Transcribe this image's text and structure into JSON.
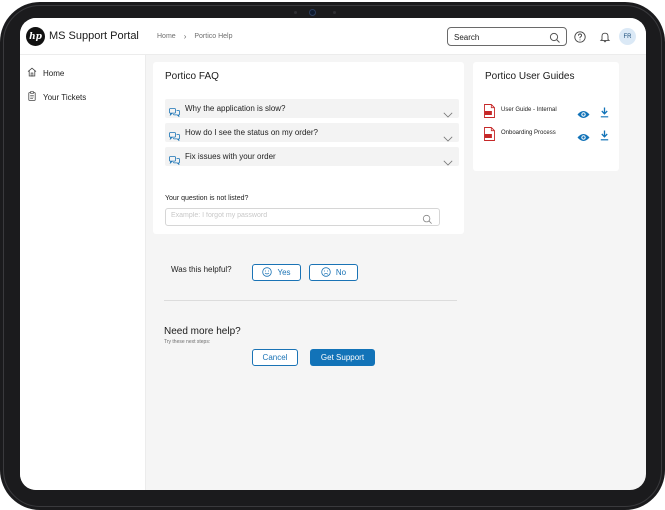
{
  "app": {
    "title": "MS Support Portal",
    "logo_text": "hp"
  },
  "breadcrumb": {
    "home": "Home",
    "current": "Portico Help"
  },
  "search": {
    "placeholder": "Search"
  },
  "avatar": {
    "initials": "FR"
  },
  "sidebar": {
    "items": [
      {
        "label": "Home",
        "icon": "home-icon"
      },
      {
        "label": "Your Tickets",
        "icon": "clipboard-icon"
      }
    ]
  },
  "faq": {
    "title": "Portico FAQ",
    "items": [
      {
        "question": "Why the application is slow?"
      },
      {
        "question": "How do I see the status on my order?"
      },
      {
        "question": "Fix issues with your order"
      }
    ],
    "not_listed_label": "Your question is not listed?",
    "search_placeholder": "Example: I forgot my password"
  },
  "guides": {
    "title": "Portico User Guides",
    "items": [
      {
        "name": "User Guide - Internal"
      },
      {
        "name": "Onboarding Process"
      }
    ]
  },
  "feedback": {
    "question": "Was this helpful?",
    "yes_label": "Yes",
    "no_label": "No"
  },
  "more_help": {
    "title": "Need more help?",
    "subtitle": "Try these next steps:",
    "cancel_label": "Cancel",
    "support_label": "Get Support"
  },
  "colors": {
    "accent": "#1273b8",
    "pdf_red": "#c62828"
  }
}
